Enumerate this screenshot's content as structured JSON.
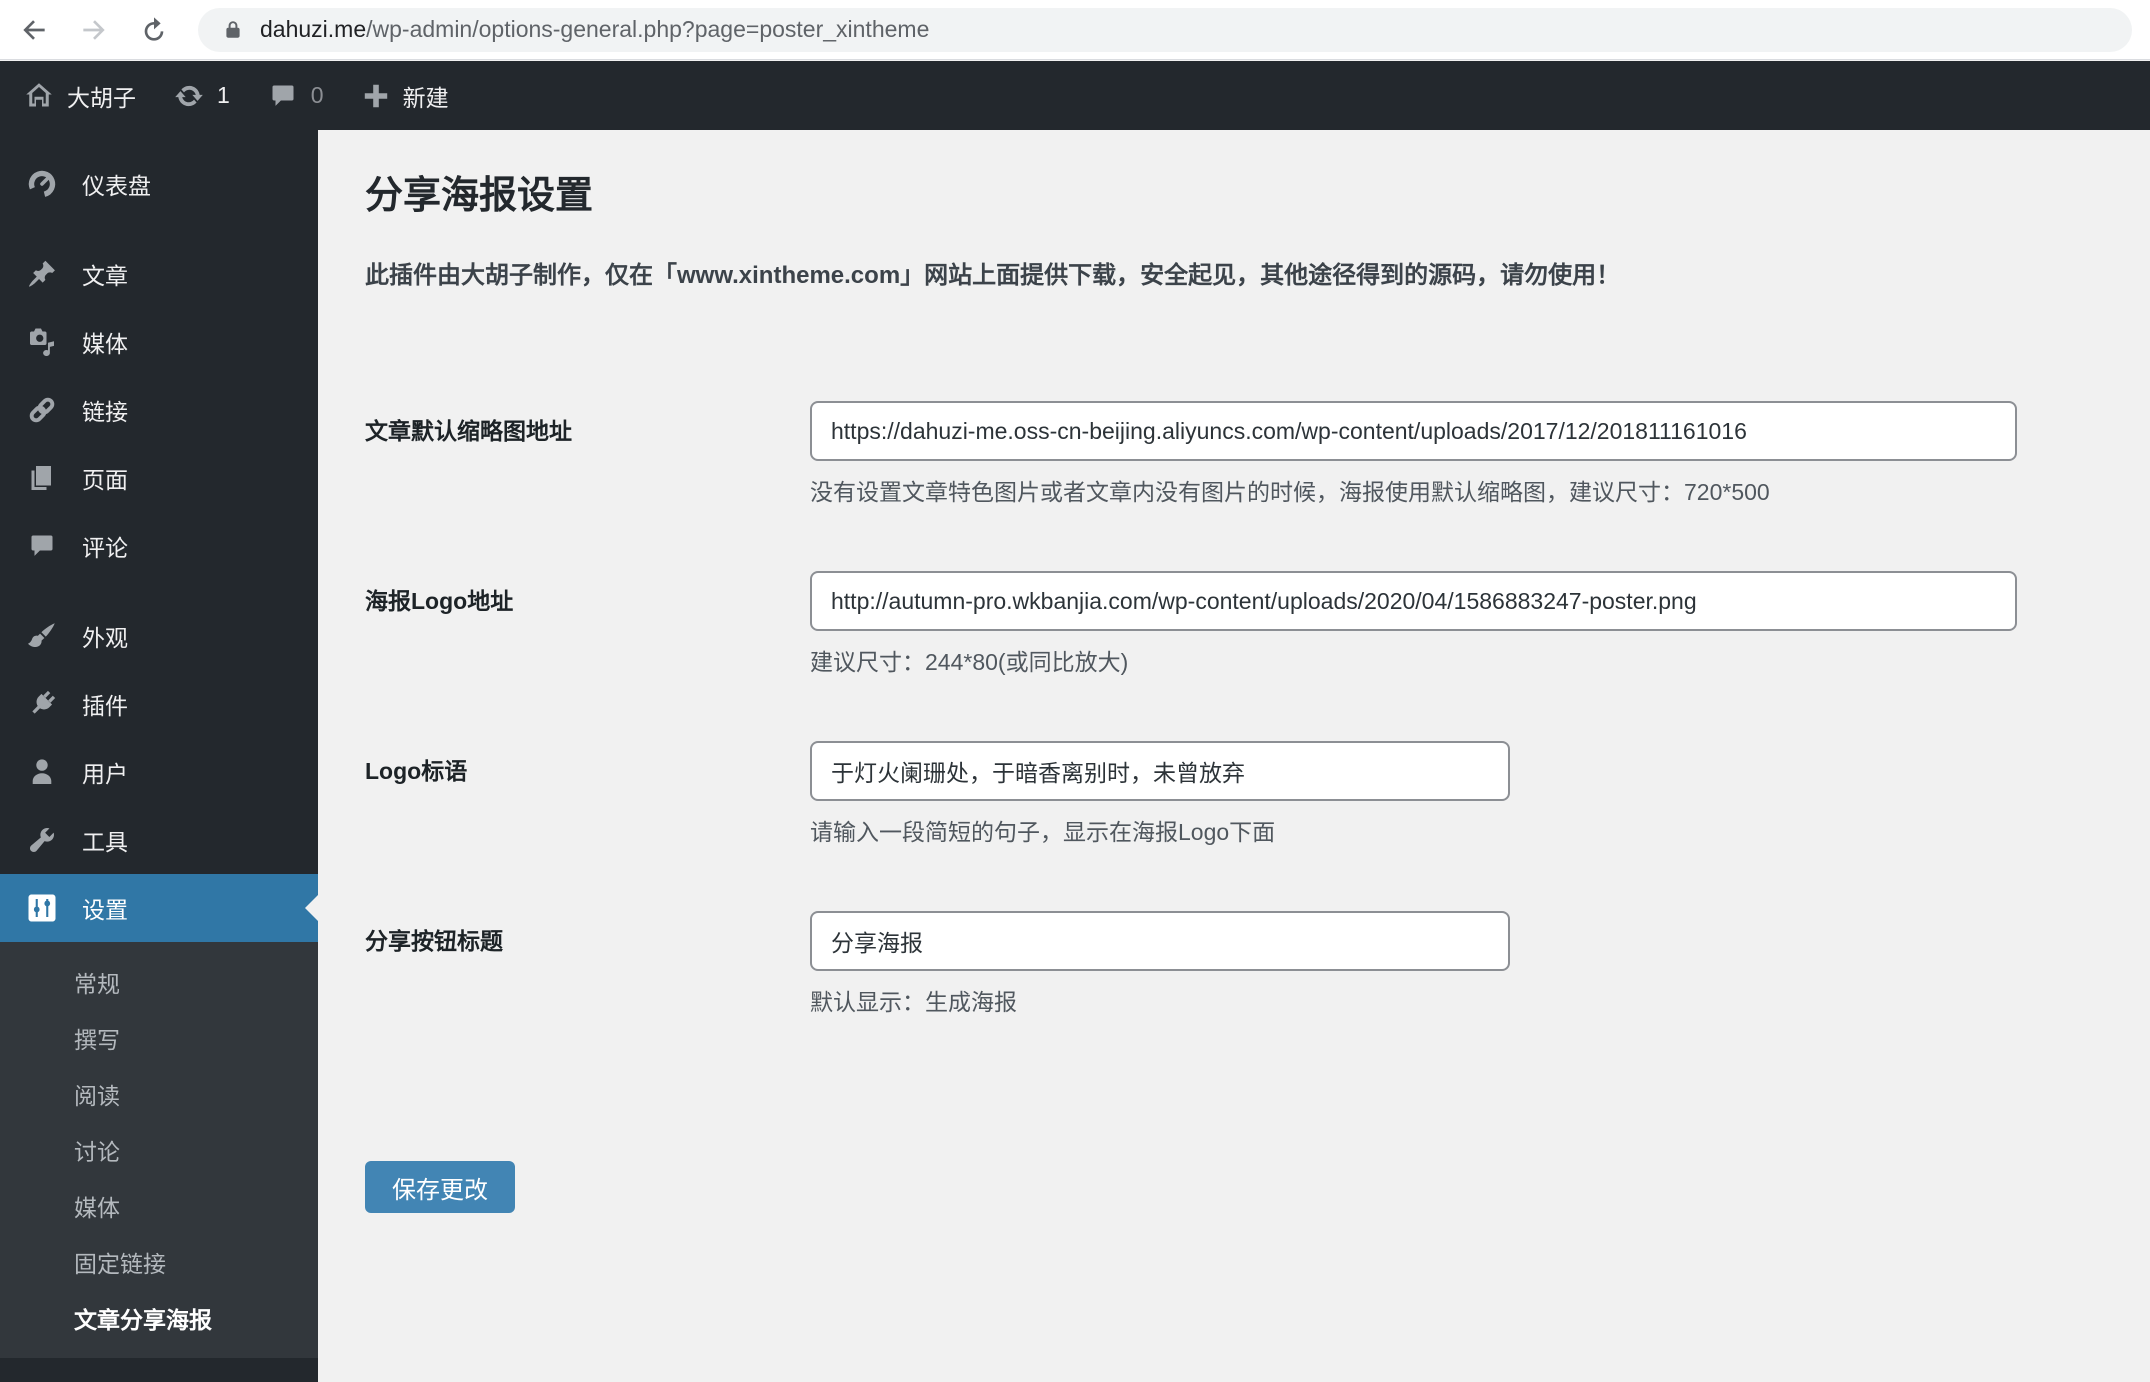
{
  "browser": {
    "url_host": "dahuzi.me",
    "url_path": "/wp-admin/options-general.php?page=poster_xintheme"
  },
  "admin_bar": {
    "site_name": "大胡子",
    "updates_count": "1",
    "comments_count": "0",
    "new_label": "新建"
  },
  "sidebar": {
    "items": [
      {
        "label": "仪表盘",
        "icon": "dashboard-icon"
      },
      {
        "label": "文章",
        "icon": "post-pin-icon"
      },
      {
        "label": "媒体",
        "icon": "media-icon"
      },
      {
        "label": "链接",
        "icon": "links-icon"
      },
      {
        "label": "页面",
        "icon": "pages-icon"
      },
      {
        "label": "评论",
        "icon": "comments-icon"
      },
      {
        "label": "外观",
        "icon": "appearance-icon"
      },
      {
        "label": "插件",
        "icon": "plugins-icon"
      },
      {
        "label": "用户",
        "icon": "users-icon"
      },
      {
        "label": "工具",
        "icon": "tools-icon"
      },
      {
        "label": "设置",
        "icon": "settings-icon",
        "active": true
      }
    ],
    "submenu": [
      {
        "label": "常规"
      },
      {
        "label": "撰写"
      },
      {
        "label": "阅读"
      },
      {
        "label": "讨论"
      },
      {
        "label": "媒体"
      },
      {
        "label": "固定链接"
      },
      {
        "label": "文章分享海报",
        "current": true
      }
    ]
  },
  "main": {
    "title": "分享海报设置",
    "notice": "此插件由大胡子制作，仅在「www.xintheme.com」网站上面提供下载，安全起见，其他途径得到的源码，请勿使用！",
    "fields": [
      {
        "label": "文章默认缩略图地址",
        "value": "https://dahuzi-me.oss-cn-beijing.aliyuncs.com/wp-content/uploads/2017/12/201811161016",
        "help": "没有设置文章特色图片或者文章内没有图片的时候，海报使用默认缩略图，建议尺寸：720*500"
      },
      {
        "label": "海报Logo地址",
        "value": "http://autumn-pro.wkbanjia.com/wp-content/uploads/2020/04/1586883247-poster.png",
        "help": "建议尺寸：244*80(或同比放大)"
      },
      {
        "label": "Logo标语",
        "value": "于灯火阑珊处，于暗香离别时，未曾放弃",
        "help": "请输入一段简短的句子，显示在海报Logo下面"
      },
      {
        "label": "分享按钮标题",
        "value": "分享海报",
        "help": "默认显示：生成海报"
      }
    ],
    "save_button": "保存更改"
  },
  "colors": {
    "admin_dark": "#23282d",
    "submenu_dark": "#32373c",
    "active_menu_blue": "#3077a6",
    "button_blue": "#4285b4",
    "content_bg": "#f1f1f1",
    "url_pill_bg": "#f1f3f4"
  }
}
